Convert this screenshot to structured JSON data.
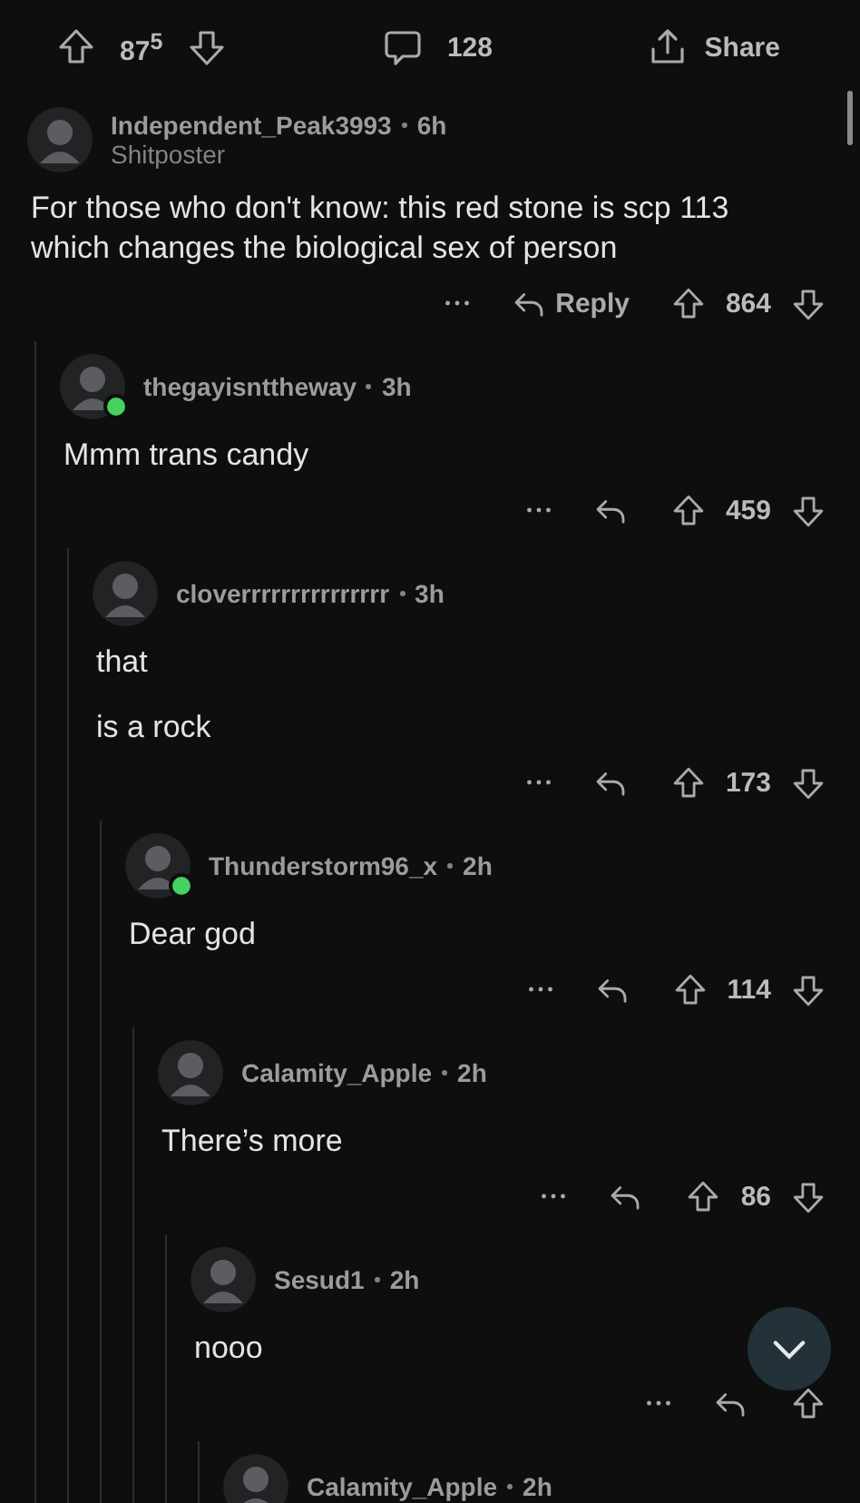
{
  "post_bar": {
    "score": "87$^{5}$",
    "comments": "128",
    "share": "Share"
  },
  "comments": [
    {
      "author": "Independent_Peak3993",
      "age": "6h",
      "flair": "Shitposter",
      "online": false,
      "body": [
        "For those who don't know: this red stone is scp 113 which changes the biological sex of person"
      ],
      "reply": "Reply",
      "score": "864",
      "children": [
        {
          "author": "thegayisnttheway",
          "age": "3h",
          "online": true,
          "body": [
            "Mmm trans candy"
          ],
          "score": "459",
          "children": [
            {
              "author": "cloverrrrrrrrrrrrrrr",
              "age": "3h",
              "online": false,
              "body": [
                "that",
                "is a rock"
              ],
              "score": "173",
              "children": [
                {
                  "author": "Thunderstorm96_x",
                  "age": "2h",
                  "online": true,
                  "body": [
                    "Dear god"
                  ],
                  "score": "114",
                  "children": [
                    {
                      "author": "Calamity_Apple",
                      "age": "2h",
                      "online": false,
                      "body": [
                        "There’s more"
                      ],
                      "score": "86",
                      "children": [
                        {
                          "author": "Sesud1",
                          "age": "2h",
                          "online": false,
                          "body": [
                            "nooo"
                          ],
                          "children": [
                            {
                              "author": "Calamity_Apple",
                              "age": "2h",
                              "online": false
                            }
                          ]
                        }
                      ]
                    }
                  ]
                }
              ]
            }
          ]
        }
      ]
    }
  ]
}
